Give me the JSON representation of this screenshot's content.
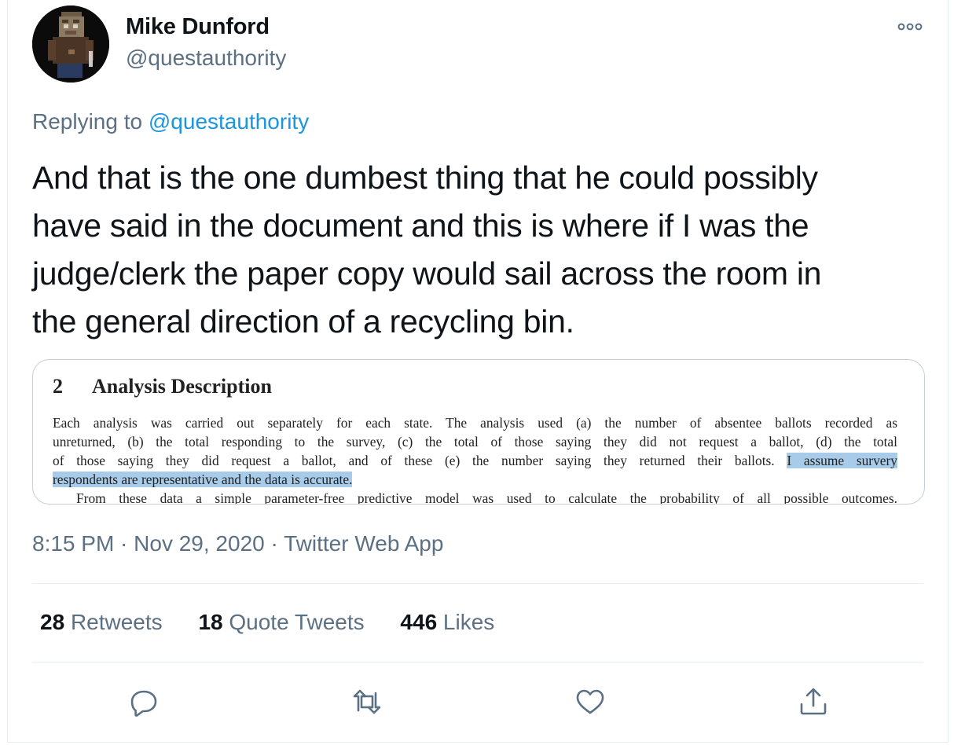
{
  "author": {
    "name": "Mike Dunford",
    "handle": "@questauthority"
  },
  "reply": {
    "prefix": "Replying to",
    "mention": "@questauthority"
  },
  "tweet": {
    "lines": [
      "And that is the one dumbest thing that he could possibly",
      "have said in the document and this is where if I was the",
      "judge/clerk the paper copy would sail across the room in",
      "the general direction of a recycling bin."
    ]
  },
  "attached_image": {
    "section_number": "2",
    "section_title": "Analysis Description",
    "lines": [
      "Each analysis was carried out separately for each state. The analysis used (a) the number of absentee ballots recorded as",
      "unreturned, (b) the total responding to the survey, (c) the total of those saying they did not request a ballot, (d) the total",
      "of those saying they did request a ballot, and of these (e) the number saying they returned their ballots."
    ],
    "highlight_part1": "I assume survery",
    "highlight_part2": "respondents are representative and the data is accurate.",
    "last_line": "From these data a simple parameter-free predictive model was used to calculate the probability of all possible outcomes."
  },
  "meta": {
    "text": "8:15 PM · Nov 29, 2020 · Twitter Web App"
  },
  "stats": {
    "retweets_count": "28",
    "retweets_label": "Retweets",
    "quotes_count": "18",
    "quotes_label": "Quote Tweets",
    "likes_count": "446",
    "likes_label": "Likes"
  },
  "icons": {
    "avatar": "avatar-icon",
    "more": "more-options-icon",
    "reply": "reply-icon",
    "retweet": "retweet-icon",
    "like": "heart-icon",
    "share": "share-icon"
  },
  "colors": {
    "link": "#1b95e0",
    "secondary_text": "#5b7083",
    "highlight": "#a7cbe8"
  }
}
